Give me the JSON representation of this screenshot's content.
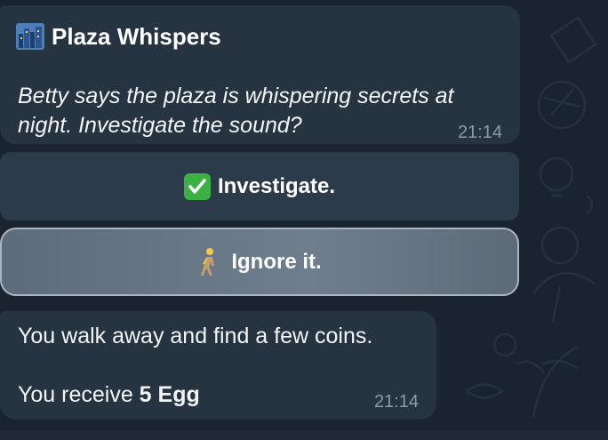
{
  "chat": {
    "message1": {
      "title": "Plaza Whispers",
      "title_icon": "cityscape-icon",
      "text": "Betty says the plaza is whispering secrets at night. Investigate the sound?",
      "time": "21:14"
    },
    "buttons": {
      "investigate": {
        "label": "Investigate.",
        "icon": "check-mark-icon"
      },
      "ignore": {
        "label": "Ignore it.",
        "icon": "person-walking-icon"
      }
    },
    "message2": {
      "line1": "You walk away and find a few coins.",
      "line2_prefix": "You receive ",
      "line2_bold": "5 Egg",
      "time": "21:14"
    }
  },
  "colors": {
    "background": "#1a2430",
    "bubble": "#263442",
    "button": "#2c3b4a",
    "selected_button": "#6f7e8d",
    "check_green": "#3cb043",
    "time_text": "#8e9aa6"
  }
}
